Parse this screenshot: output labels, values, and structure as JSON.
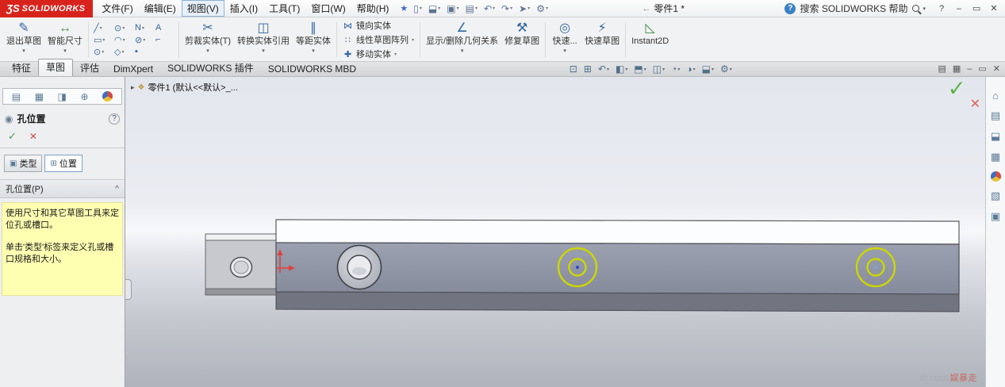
{
  "glyphs": {
    "caret_down": "▾",
    "caret_right": "▸",
    "collapse": "^",
    "check": "✓",
    "close": "✕",
    "minimize": "–",
    "maximize": "▭",
    "star": "★",
    "back_arrow": "←",
    "part": "❖"
  },
  "colors": {
    "accent_red": "#d8231c",
    "sketch_yellow": "#cdd600",
    "origin_red": "#e0403c",
    "check_green": "#5cb14e",
    "cancel_red": "#d04a42",
    "note_yellow": "#ffffb2",
    "model_gray": "#8f95a4"
  },
  "menubar": {
    "logo_mark": "ƷS",
    "logo_text": "SOLIDWORKS",
    "menus": [
      {
        "label": "文件(F)"
      },
      {
        "label": "编辑(E)"
      },
      {
        "label": "视图(V)"
      },
      {
        "label": "插入(I)"
      },
      {
        "label": "工具(T)"
      },
      {
        "label": "窗口(W)"
      },
      {
        "label": "帮助(H)"
      }
    ],
    "doc_title": "零件1 *",
    "help_badge": "?",
    "search_label": "搜索 SOLIDWORKS 帮助",
    "help_button": "?"
  },
  "quick_access": [
    {
      "name": "new",
      "glyph": "▯"
    },
    {
      "name": "open",
      "glyph": "⬓"
    },
    {
      "name": "save",
      "glyph": "▣"
    },
    {
      "name": "print",
      "glyph": "▤"
    },
    {
      "name": "undo",
      "glyph": "↶"
    },
    {
      "name": "redo",
      "glyph": "↷"
    },
    {
      "name": "select",
      "glyph": "➤"
    },
    {
      "name": "options",
      "glyph": "⚙"
    }
  ],
  "ribbon": {
    "exit_sketch": {
      "label": "退出草图",
      "glyph": "✎"
    },
    "smart_dimension": {
      "label": "智能尺寸",
      "glyph": "↔"
    },
    "trim": {
      "label": "剪裁实体(T)",
      "glyph": "✂"
    },
    "convert": {
      "label": "转换实体引用",
      "glyph": "◫"
    },
    "offset": {
      "label": "等距实体",
      "glyph": "∥"
    },
    "mirror": {
      "label": "镜向实体",
      "glyph": "⋈"
    },
    "pattern": {
      "label": "线性草图阵列",
      "glyph": "∷"
    },
    "move": {
      "label": "移动实体",
      "glyph": "✚"
    },
    "relations": {
      "label": "显示/删除几何关系",
      "glyph": "∠"
    },
    "repair": {
      "label": "修复草图",
      "glyph": "⚒"
    },
    "quick_snaps": {
      "label": "快速...",
      "glyph": "◎"
    },
    "rapid_sketch": {
      "label": "快速草图",
      "glyph": "⚡"
    },
    "instant2d": {
      "label": "Instant2D",
      "glyph": "◺"
    },
    "tools": [
      {
        "name": "line",
        "glyph": "╱"
      },
      {
        "name": "circle",
        "glyph": "⊙"
      },
      {
        "name": "spline",
        "glyph": "N"
      },
      {
        "name": "text",
        "glyph": "A"
      },
      {
        "name": "rectangle",
        "glyph": "▭"
      },
      {
        "name": "arc",
        "glyph": "◠"
      },
      {
        "name": "ellipse",
        "glyph": "⊘"
      },
      {
        "name": "fillet",
        "glyph": "⌐"
      },
      {
        "name": "slot",
        "glyph": "⊙"
      },
      {
        "name": "polygon",
        "glyph": "◇"
      },
      {
        "name": "point",
        "glyph": "▪"
      }
    ]
  },
  "tabs": [
    {
      "label": "特征"
    },
    {
      "label": "草图"
    },
    {
      "label": "评估"
    },
    {
      "label": "DimXpert"
    },
    {
      "label": "SOLIDWORKS 插件"
    },
    {
      "label": "SOLIDWORKS MBD"
    }
  ],
  "headsup": [
    {
      "name": "zoom-to-fit",
      "glyph": "⊡"
    },
    {
      "name": "zoom-to-area",
      "glyph": "⊞"
    },
    {
      "name": "previous-view",
      "glyph": "↶"
    },
    {
      "name": "section-view",
      "glyph": "◧"
    },
    {
      "name": "view-orientation",
      "glyph": "⬒"
    },
    {
      "name": "display-style",
      "glyph": "◫"
    },
    {
      "name": "hide-show-items",
      "glyph": "◔"
    },
    {
      "name": "edit-appearance",
      "glyph": "◑"
    },
    {
      "name": "apply-scene",
      "glyph": "⬓"
    },
    {
      "name": "view-settings",
      "glyph": "⚙"
    }
  ],
  "doc_controls": [
    {
      "name": "show-pane",
      "glyph": "▤"
    },
    {
      "name": "split-pane",
      "glyph": "▦"
    },
    {
      "name": "doc-minimize",
      "glyph": "–"
    },
    {
      "name": "doc-restore",
      "glyph": "▭"
    },
    {
      "name": "doc-close",
      "glyph": "✕"
    }
  ],
  "panel": {
    "title": "孔位置",
    "hicon": "◉",
    "help": "?",
    "ok": "✓",
    "cancel": "✕",
    "tab_type": "类型",
    "tab_position": "位置",
    "type_icon": "▣",
    "position_icon": "⊞",
    "section": "孔位置(P)",
    "note1": "使用尺寸和其它草图工具来定位孔或槽口。",
    "note2": "单击'类型'标签来定义孔或槽口规格和大小。"
  },
  "pm_tabs": [
    {
      "name": "featuremanager",
      "glyph": "▤"
    },
    {
      "name": "propertymanager",
      "glyph": "▦"
    },
    {
      "name": "configurationmanager",
      "glyph": "◨"
    },
    {
      "name": "dimxpertmanager",
      "glyph": "⊕"
    },
    {
      "name": "displaymanager",
      "glyph": ""
    }
  ],
  "task_pane": [
    {
      "name": "resources",
      "glyph": "⌂"
    },
    {
      "name": "design-library",
      "glyph": "▤"
    },
    {
      "name": "file-explorer",
      "glyph": "⬓"
    },
    {
      "name": "view-palette",
      "glyph": "▦"
    },
    {
      "name": "appearances",
      "glyph": ""
    },
    {
      "name": "custom-properties",
      "glyph": "▧"
    },
    {
      "name": "forum",
      "glyph": "▣"
    }
  ],
  "viewport": {
    "tree_item": "零件1 (默认<<默认>_...",
    "watermark_left": "dccccit",
    "watermark_right": "娱暴走"
  }
}
